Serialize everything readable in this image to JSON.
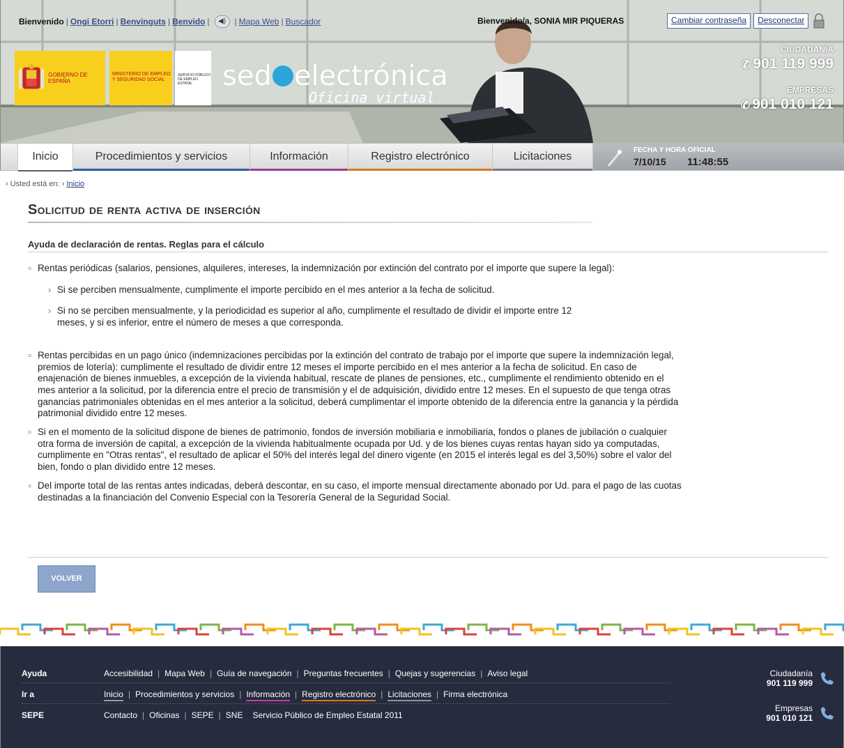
{
  "header": {
    "languages": {
      "active": "Bienvenido",
      "others": [
        "Ongi Etorri",
        "Benvinguts",
        "Benvido"
      ]
    },
    "top_links": [
      "Mapa Web",
      "Buscador"
    ],
    "welcome_user": "Bienvenido/a, SONIA MIR PIQUERAS",
    "change_password": "Cambiar contraseña",
    "logout": "Desconectar",
    "logos": {
      "gov": "GOBIERNO DE ESPAÑA",
      "ministry": "MINISTERIO DE EMPLEO Y SEGURIDAD SOCIAL",
      "sepe": "SERVICIO PÚBLICO DE EMPLEO ESTATAL"
    },
    "brand": {
      "part1": "sed",
      "part2": "electrónica",
      "subtitle": "Oficina virtual"
    },
    "phones": {
      "citizen_label": "CIUDADANÍA",
      "citizen_number": "901 119 999",
      "business_label": "EMPRESAS",
      "business_number": "901 010 121"
    }
  },
  "nav": {
    "tabs": [
      {
        "label": "Inicio",
        "color": "#5a5a5a"
      },
      {
        "label": "Procedimientos y servicios",
        "color": "#2b5aa0"
      },
      {
        "label": "Información",
        "color": "#9b3d93"
      },
      {
        "label": "Registro electrónico",
        "color": "#d97a1e"
      },
      {
        "label": "Licitaciones",
        "color": "#6e7a87"
      }
    ],
    "clock": {
      "label": "FECHA Y HORA OFICIAL",
      "date": "7/10/15",
      "time": "11:48:55"
    }
  },
  "breadcrumb": {
    "prefix": "Usted está en:",
    "link": "Inicio"
  },
  "page": {
    "title": "Solicitud de renta activa de inserción",
    "subheading": "Ayuda de declaración de rentas. Reglas para el cálculo",
    "items": [
      {
        "text": "Rentas periódicas (salarios, pensiones, alquileres, intereses, la indemnización por extinción del contrato por el importe que supere la legal):",
        "subitems": [
          "Si se perciben mensualmente, cumplimente el importe percibido en el mes anterior a la fecha de solicitud.",
          "Si no se perciben mensualmente, y la periodicidad es superior al año, cumplimente el resultado de dividir el importe entre 12 meses, y si es inferior, entre el número de meses a que corresponda."
        ]
      },
      {
        "text": "Rentas percibidas en un pago único (indemnizaciones percibidas por la extinción del contrato de trabajo por el importe que supere la indemnización legal, premios de lotería): cumplimente el resultado de dividir entre 12 meses el importe percibido en el mes anterior a la fecha de solicitud. En caso de enajenación de bienes inmuebles, a excepción de la vivienda habitual, rescate de planes de pensiones, etc., cumplimente el rendimiento obtenido en el mes anterior a la solicitud, por la diferencia entre el precio de transmisión y el de adquisición, dividido entre 12 meses. En el supuesto de que tenga otras ganancias patrimoniales obtenidas en el mes anterior a la solicitud, deberá cumplimentar el importe obtenido de la diferencia entre la ganancia y la pérdida patrimonial dividido entre 12 meses."
      },
      {
        "text": "Si en el momento de la solicitud dispone de bienes de patrimonio, fondos de inversión mobiliaria e inmobiliaria, fondos o planes de jubilación o cualquier otra forma de inversión de capital, a excepción de la vivienda habitualmente ocupada por Ud. y de los bienes cuyas rentas hayan sido ya computadas, cumplimente en \"Otras rentas\", el resultado de aplicar el 50% del interés legal del dinero vigente (en 2015 el interés legal es del 3,50%) sobre el valor del bien, fondo o plan dividido entre 12 meses."
      },
      {
        "text": "Del importe total de las rentas antes indicadas, deberá descontar, en su caso, el importe mensual directamente abonado por Ud. para el pago de las cuotas destinadas a la financiación del Convenio Especial con la Tesorería General de la Seguridad Social."
      }
    ],
    "back_button": "VOLVER"
  },
  "footer": {
    "rows": [
      {
        "label": "Ayuda",
        "links": [
          "Accesibilidad",
          "Mapa Web",
          "Guía de navegación",
          "Preguntas frecuentes",
          "Quejas y sugerencias",
          "Aviso legal"
        ]
      },
      {
        "label": "Ir a",
        "links": [
          "Inicio",
          "Procedimientos y servicios",
          "Información",
          "Registro electrónico",
          "Licitaciones",
          "Firma electrónica"
        ],
        "underline_colors": [
          "#9a9a9a",
          "",
          "#c0409a",
          "#d97a1e",
          "#8a95a3",
          ""
        ]
      },
      {
        "label": "SEPE",
        "links": [
          "Contacto",
          "Oficinas",
          "SEPE",
          "SNE"
        ],
        "trailing_text": "Servicio Público de Empleo Estatal 2011"
      }
    ],
    "phones": {
      "citizen_label": "Ciudadanía",
      "citizen_number": "901 119 999",
      "business_label": "Empresas",
      "business_number": "901 010 121"
    }
  }
}
